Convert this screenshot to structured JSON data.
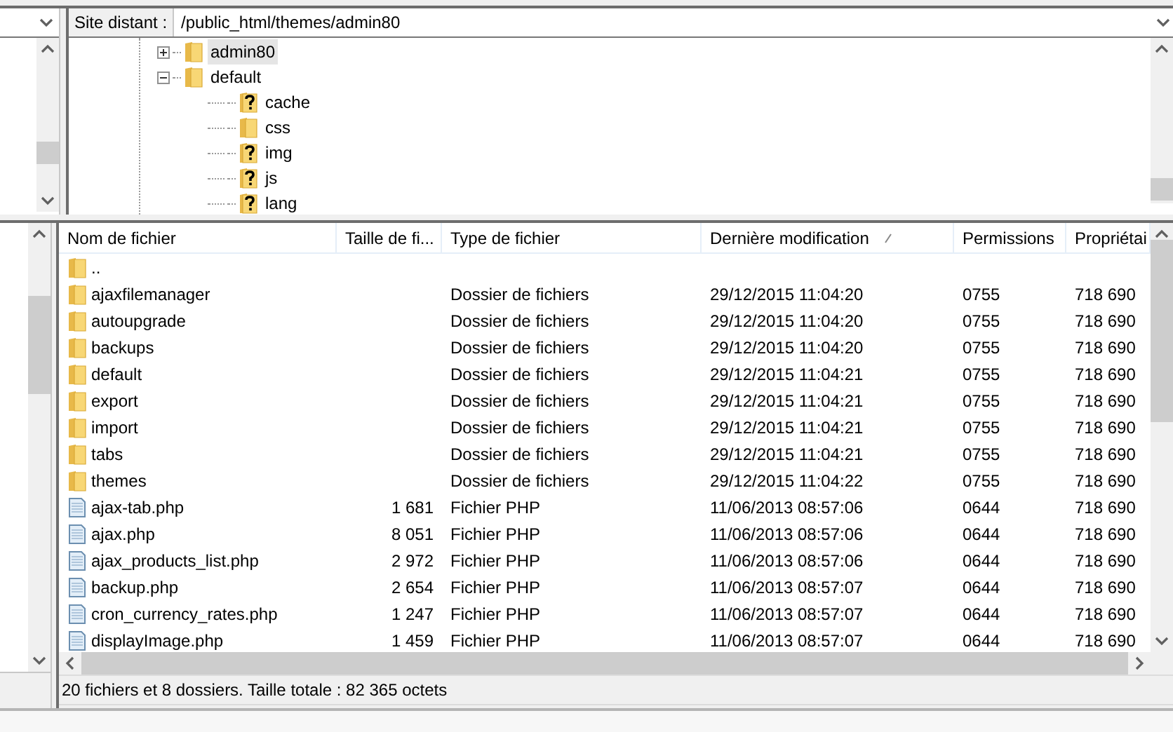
{
  "remote_site": {
    "label": "Site distant :",
    "path": "/public_html/themes/admin80"
  },
  "tree": [
    {
      "name": "admin80",
      "kind": "folder",
      "expanded": false,
      "selected": true
    },
    {
      "name": "default",
      "kind": "folder",
      "expanded": true,
      "selected": false,
      "children": [
        {
          "name": "cache",
          "kind": "unknown",
          "selected": false
        },
        {
          "name": "css",
          "kind": "folder",
          "selected": false
        },
        {
          "name": "img",
          "kind": "unknown",
          "selected": false
        },
        {
          "name": "js",
          "kind": "unknown",
          "selected": false
        },
        {
          "name": "lang",
          "kind": "unknown",
          "selected": false
        }
      ]
    }
  ],
  "table": {
    "columns": [
      {
        "label": "Nom de fichier",
        "sorted": false
      },
      {
        "label": "Taille de fi...",
        "sorted": false
      },
      {
        "label": "Type de fichier",
        "sorted": false
      },
      {
        "label": "Dernière modification",
        "sorted": true
      },
      {
        "label": "Permissions",
        "sorted": false
      },
      {
        "label": "Propriétai",
        "sorted": false
      }
    ],
    "rows": [
      {
        "kind": "folder",
        "name": "..",
        "size": "",
        "type": "",
        "modified": "",
        "permissions": "",
        "owner": ""
      },
      {
        "kind": "folder",
        "name": "ajaxfilemanager",
        "size": "",
        "type": "Dossier de fichiers",
        "modified": "29/12/2015 11:04:20",
        "permissions": "0755",
        "owner": "718 690"
      },
      {
        "kind": "folder",
        "name": "autoupgrade",
        "size": "",
        "type": "Dossier de fichiers",
        "modified": "29/12/2015 11:04:20",
        "permissions": "0755",
        "owner": "718 690"
      },
      {
        "kind": "folder",
        "name": "backups",
        "size": "",
        "type": "Dossier de fichiers",
        "modified": "29/12/2015 11:04:20",
        "permissions": "0755",
        "owner": "718 690"
      },
      {
        "kind": "folder",
        "name": "default",
        "size": "",
        "type": "Dossier de fichiers",
        "modified": "29/12/2015 11:04:21",
        "permissions": "0755",
        "owner": "718 690"
      },
      {
        "kind": "folder",
        "name": "export",
        "size": "",
        "type": "Dossier de fichiers",
        "modified": "29/12/2015 11:04:21",
        "permissions": "0755",
        "owner": "718 690"
      },
      {
        "kind": "folder",
        "name": "import",
        "size": "",
        "type": "Dossier de fichiers",
        "modified": "29/12/2015 11:04:21",
        "permissions": "0755",
        "owner": "718 690"
      },
      {
        "kind": "folder",
        "name": "tabs",
        "size": "",
        "type": "Dossier de fichiers",
        "modified": "29/12/2015 11:04:21",
        "permissions": "0755",
        "owner": "718 690"
      },
      {
        "kind": "folder",
        "name": "themes",
        "size": "",
        "type": "Dossier de fichiers",
        "modified": "29/12/2015 11:04:22",
        "permissions": "0755",
        "owner": "718 690"
      },
      {
        "kind": "file",
        "name": "ajax-tab.php",
        "size": "1 681",
        "type": "Fichier PHP",
        "modified": "11/06/2013 08:57:06",
        "permissions": "0644",
        "owner": "718 690"
      },
      {
        "kind": "file",
        "name": "ajax.php",
        "size": "8 051",
        "type": "Fichier PHP",
        "modified": "11/06/2013 08:57:06",
        "permissions": "0644",
        "owner": "718 690"
      },
      {
        "kind": "file",
        "name": "ajax_products_list.php",
        "size": "2 972",
        "type": "Fichier PHP",
        "modified": "11/06/2013 08:57:06",
        "permissions": "0644",
        "owner": "718 690"
      },
      {
        "kind": "file",
        "name": "backup.php",
        "size": "2 654",
        "type": "Fichier PHP",
        "modified": "11/06/2013 08:57:07",
        "permissions": "0644",
        "owner": "718 690"
      },
      {
        "kind": "file",
        "name": "cron_currency_rates.php",
        "size": "1 247",
        "type": "Fichier PHP",
        "modified": "11/06/2013 08:57:07",
        "permissions": "0644",
        "owner": "718 690"
      },
      {
        "kind": "file",
        "name": "displayImage.php",
        "size": "1 459",
        "type": "Fichier PHP",
        "modified": "11/06/2013 08:57:07",
        "permissions": "0644",
        "owner": "718 690"
      }
    ]
  },
  "status_bar": "20 fichiers et 8 dossiers. Taille totale : 82 365 octets"
}
